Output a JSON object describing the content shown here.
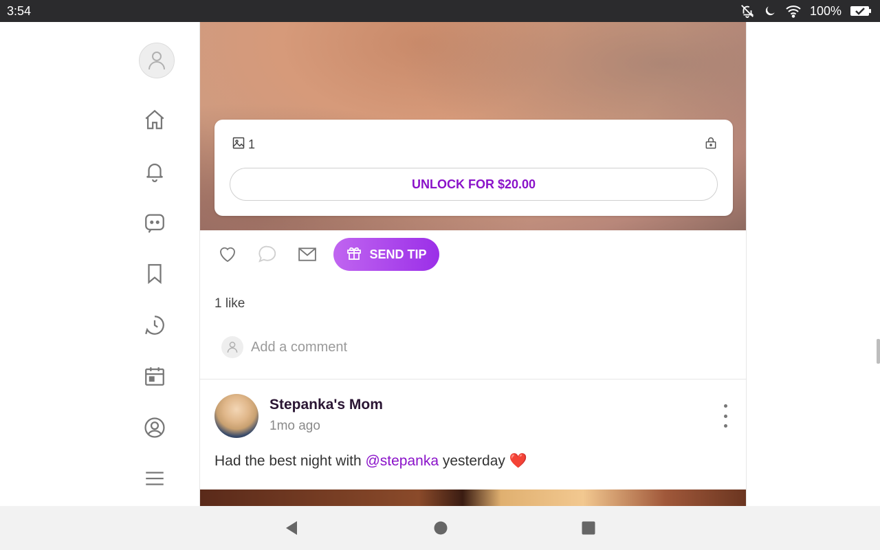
{
  "status_bar": {
    "time": "3:54",
    "battery": "100%",
    "icons": [
      "notifications-off-icon",
      "moon-icon",
      "wifi-icon",
      "battery-icon"
    ]
  },
  "sidebar": {
    "items": [
      {
        "name": "home-icon"
      },
      {
        "name": "bell-icon"
      },
      {
        "name": "messages-icon"
      },
      {
        "name": "bookmark-icon"
      },
      {
        "name": "history-icon"
      },
      {
        "name": "calendar-icon"
      },
      {
        "name": "profile-icon"
      },
      {
        "name": "menu-icon"
      }
    ]
  },
  "locked_post": {
    "media_count": "1",
    "unlock_label": "UNLOCK FOR $20.00"
  },
  "actions": {
    "tip_label": "SEND TIP"
  },
  "likes_text": "1 like",
  "comment": {
    "placeholder": "Add a comment"
  },
  "next_post": {
    "author": "Stepanka's Mom",
    "time": "1mo ago",
    "text_before": "Had the best night with ",
    "mention": "@stepanka",
    "text_after": " yesterday ❤️"
  },
  "colors": {
    "accent": "#8a12c9",
    "tip_gradient_start": "#c065f0",
    "tip_gradient_end": "#9b2fe8"
  }
}
